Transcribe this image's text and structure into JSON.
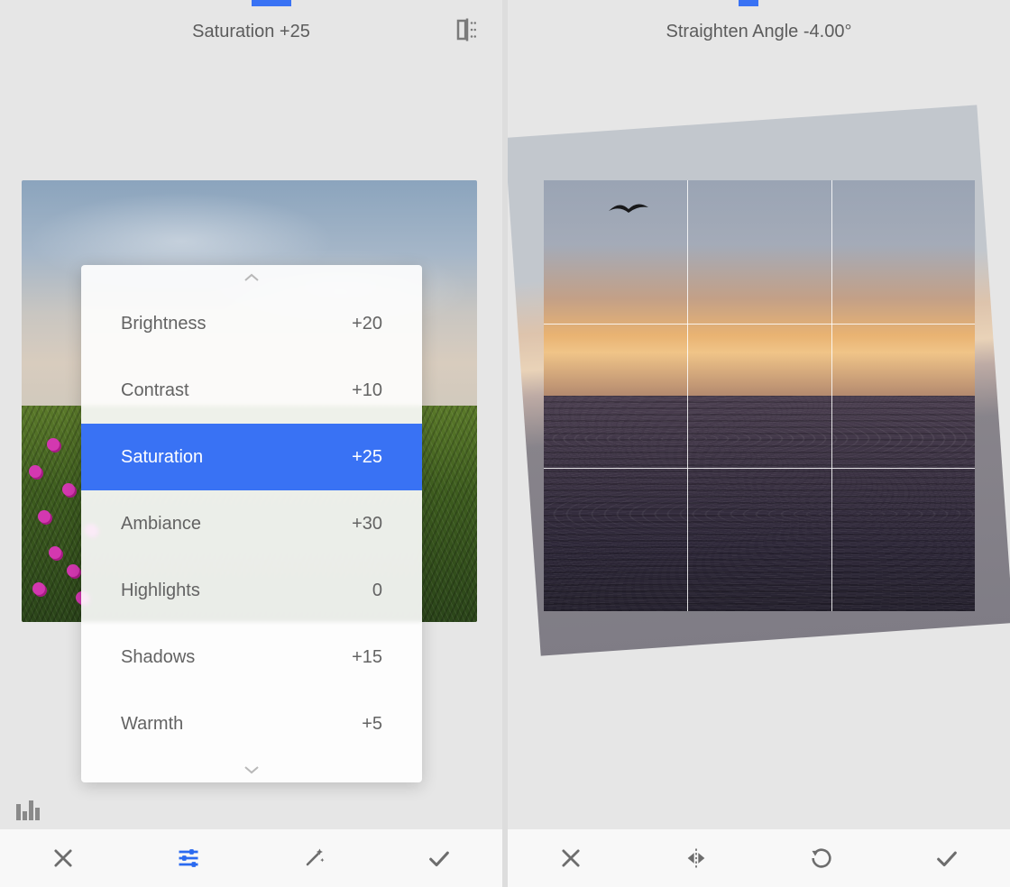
{
  "left": {
    "title": "Saturation +25",
    "slider": {
      "start_pct": 50,
      "width_pct": 8
    },
    "tune_items": [
      {
        "label": "Brightness",
        "value": "+20",
        "selected": false
      },
      {
        "label": "Contrast",
        "value": "+10",
        "selected": false
      },
      {
        "label": "Saturation",
        "value": "+25",
        "selected": true
      },
      {
        "label": "Ambiance",
        "value": "+30",
        "selected": false
      },
      {
        "label": "Highlights",
        "value": "0",
        "selected": false
      },
      {
        "label": "Shadows",
        "value": "+15",
        "selected": false
      },
      {
        "label": "Warmth",
        "value": "+5",
        "selected": false
      }
    ],
    "toolbar": {
      "close": "close",
      "tune": "tune",
      "wand": "auto-enhance",
      "apply": "apply"
    }
  },
  "right": {
    "title": "Straighten Angle -4.00°",
    "slider": {
      "start_pct": 46,
      "width_pct": 4
    },
    "toolbar": {
      "close": "close",
      "flip": "flip-horizontal",
      "rotate": "rotate-cw",
      "apply": "apply"
    }
  },
  "colors": {
    "accent": "#3972f4"
  }
}
